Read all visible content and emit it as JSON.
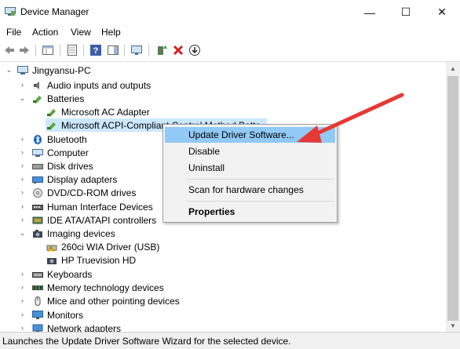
{
  "window": {
    "title": "Device Manager",
    "minimize_glyph": "—",
    "maximize_glyph": "☐",
    "close_glyph": "✕"
  },
  "menu": [
    "File",
    "Action",
    "View",
    "Help"
  ],
  "toolbar": {
    "icons": [
      "back-icon",
      "forward-icon",
      "properties-grid-icon",
      "show-hide-tree-icon",
      "help-icon",
      "action-pane-icon",
      "computer-monitor-icon",
      "update-driver-icon",
      "uninstall-icon",
      "scan-download-icon"
    ]
  },
  "tree": {
    "root": "Jingyansu-PC",
    "items": [
      {
        "label": "Audio inputs and outputs",
        "icon": "speaker-icon",
        "expanded": false
      },
      {
        "label": "Batteries",
        "icon": "battery-icon",
        "expanded": true
      },
      {
        "label": "Microsoft AC Adapter",
        "icon": "battery-icon",
        "child": true
      },
      {
        "label": "Microsoft ACPI-Compliant Control Method Batte",
        "icon": "battery-icon",
        "child": true,
        "selected": true
      },
      {
        "label": "Bluetooth",
        "icon": "bluetooth-icon",
        "expanded": false
      },
      {
        "label": "Computer",
        "icon": "computer-icon",
        "expanded": false
      },
      {
        "label": "Disk drives",
        "icon": "disk-icon",
        "expanded": false
      },
      {
        "label": "Display adapters",
        "icon": "display-icon",
        "expanded": false
      },
      {
        "label": "DVD/CD-ROM drives",
        "icon": "dvd-icon",
        "expanded": false
      },
      {
        "label": "Human Interface Devices",
        "icon": "hid-icon",
        "expanded": false
      },
      {
        "label": "IDE ATA/ATAPI controllers",
        "icon": "ide-icon",
        "expanded": false
      },
      {
        "label": "Imaging devices",
        "icon": "camera-icon",
        "expanded": true
      },
      {
        "label": "260ci WIA Driver (USB)",
        "icon": "warning-scanner-icon",
        "child": true
      },
      {
        "label": "HP Truevision HD",
        "icon": "webcam-icon",
        "child": true
      },
      {
        "label": "Keyboards",
        "icon": "keyboard-icon",
        "expanded": false
      },
      {
        "label": "Memory technology devices",
        "icon": "memory-icon",
        "expanded": false
      },
      {
        "label": "Mice and other pointing devices",
        "icon": "mouse-icon",
        "expanded": false
      },
      {
        "label": "Monitors",
        "icon": "monitor-icon",
        "expanded": false
      },
      {
        "label": "Network adapters",
        "icon": "network-icon",
        "expanded": false
      }
    ]
  },
  "context_menu": {
    "items": [
      "Update Driver Software...",
      "Disable",
      "Uninstall",
      "Scan for hardware changes",
      "Properties"
    ]
  },
  "status": "Launches the Update Driver Software Wizard for the selected device.",
  "colors": {
    "accent_highlight": "#91c9f7",
    "selection": "#cce8ff",
    "annotation_arrow": "#e53935"
  }
}
